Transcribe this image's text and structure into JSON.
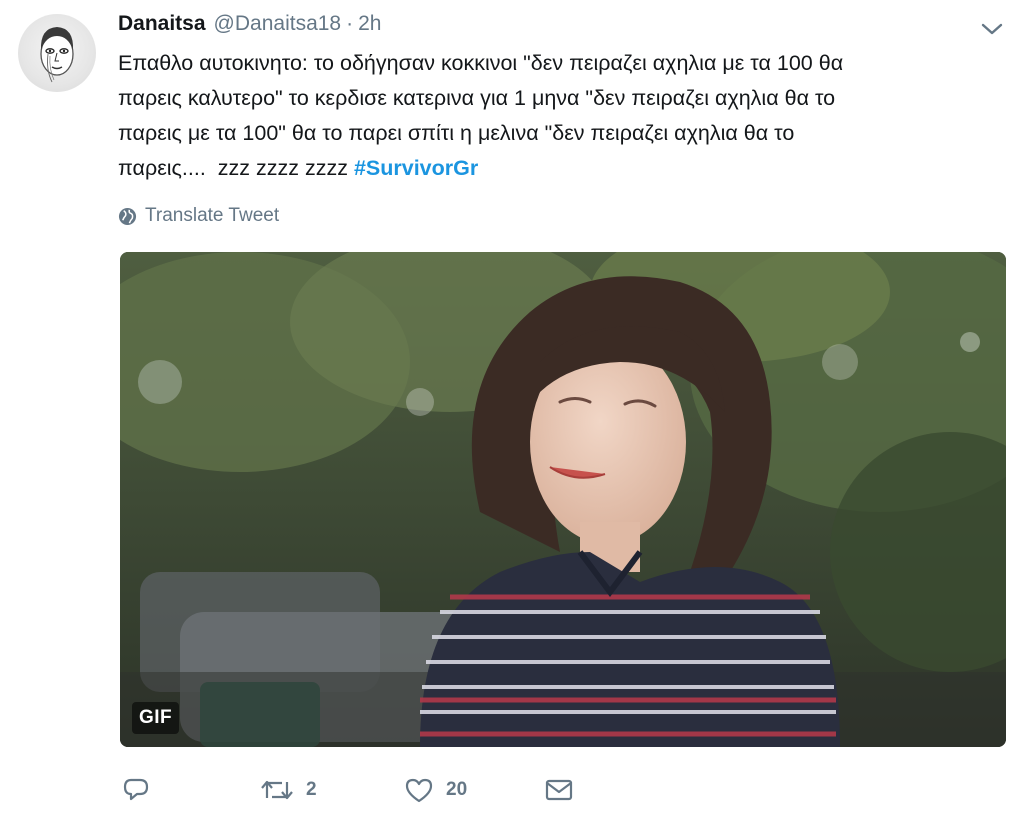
{
  "author": {
    "display_name": "Danaitsa",
    "handle": "@Danaitsa18",
    "separator": "·",
    "time": "2h"
  },
  "tweet": {
    "lines": [
      "Επαθλο αυτοκινητο: το οδήγησαν κοκκινοι \"δεν πειραζει αχηλια με τα 100 θα",
      "παρεις καλυτερο\" το κερδισε κατερινα για 1 μηνα \"δεν πειραζει αχηλια θα το",
      "παρεις με τα 100\" θα το παρει σπίτι η μελινα \"δεν πειραζει αχηλια θα το",
      "παρεις....  zzz zzzz zzzz "
    ],
    "hashtag": "#SurvivorGr"
  },
  "translate_label": "Translate Tweet",
  "media": {
    "badge": "GIF"
  },
  "actions": {
    "reply_count": "",
    "retweet_count": "2",
    "like_count": "20"
  },
  "icons": {
    "reply": "reply-icon",
    "retweet": "retweet-icon",
    "like": "heart-icon",
    "message": "envelope-icon",
    "translate": "globe-icon",
    "more": "chevron-down-icon"
  },
  "colors": {
    "text": "#14171a",
    "secondary": "#657786",
    "link": "#1b95e0"
  }
}
